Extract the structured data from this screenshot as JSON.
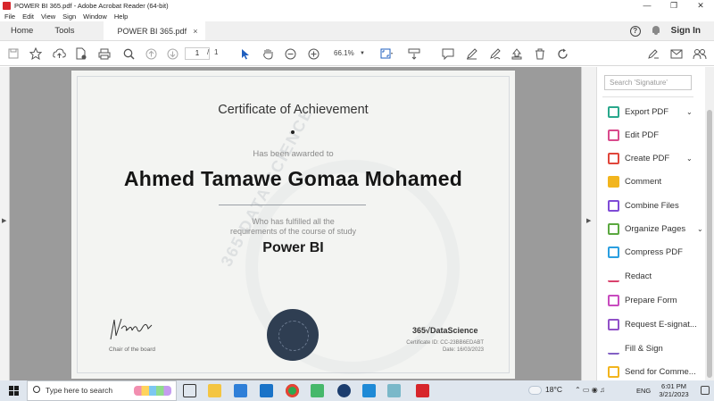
{
  "window": {
    "title": "POWER BI 365.pdf - Adobe Acrobat Reader (64-bit)",
    "controls": [
      "—",
      "❐",
      "✕"
    ]
  },
  "menu": [
    "File",
    "Edit",
    "View",
    "Sign",
    "Window",
    "Help"
  ],
  "tabs": {
    "home": "Home",
    "tools": "Tools",
    "document": "POWER BI 365.pdf",
    "close": "×",
    "sign_in": "Sign In"
  },
  "toolbar": {
    "page_current": "1",
    "page_separator": "/",
    "page_total": "1",
    "zoom": "66.1%"
  },
  "certificate": {
    "title": "Certificate of Achievement",
    "awarded": "Has been awarded to",
    "recipient": "Ahmed  Tamawe Gomaa Mohamed",
    "fulfilled_line1": "Who has fulfilled all the",
    "fulfilled_line2": "requirements of the course of study",
    "course": "Power BI",
    "signature_text": "N Koster",
    "signer_role": "Chair of the board",
    "brand": "365√DataScience",
    "certificate_id": "Certificate ID:  CC-23BB6EDABT",
    "date": "Date: 16/03/2023",
    "watermark_text": "365 DATA SCIENCE"
  },
  "right_panel": {
    "search_placeholder": "Search 'Signature'",
    "items": [
      {
        "label": "Export PDF",
        "color": "#2aa88c"
      },
      {
        "label": "Edit PDF",
        "color": "#d94a8c"
      },
      {
        "label": "Create PDF",
        "color": "#e0463b"
      },
      {
        "label": "Comment",
        "color": "#f2b51e"
      },
      {
        "label": "Combine Files",
        "color": "#7f4bd6"
      },
      {
        "label": "Organize Pages",
        "color": "#5ba840"
      },
      {
        "label": "Compress PDF",
        "color": "#2b9fe0"
      },
      {
        "label": "Redact",
        "color": "#d9426c"
      },
      {
        "label": "Prepare Form",
        "color": "#c84bbf"
      },
      {
        "label": "Request E-signat...",
        "color": "#9151c8"
      },
      {
        "label": "Fill & Sign",
        "color": "#8260c4"
      },
      {
        "label": "Send for Comme...",
        "color": "#f2b51e"
      }
    ]
  },
  "taskbar": {
    "search_placeholder": "Type here to search",
    "temperature": "18°C",
    "language": "ENG",
    "time": "6:01 PM",
    "date": "3/21/2023"
  }
}
